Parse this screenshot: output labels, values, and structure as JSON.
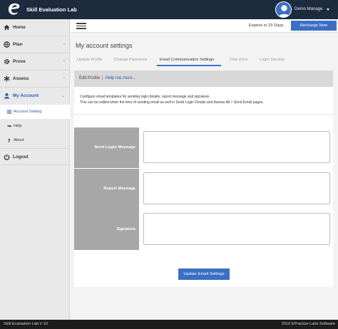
{
  "app": {
    "title": "Skill Evaluation Lab",
    "user_name": "Demo Manage"
  },
  "header": {
    "expires_text": "Expires in 23 Days.",
    "recharge_label": "Recharge Now"
  },
  "sidebar": {
    "items": [
      {
        "label": "Home",
        "icon": "home-icon"
      },
      {
        "label": "Plan",
        "icon": "globe-icon",
        "chevron": "‹"
      },
      {
        "label": "Prove",
        "icon": "cog-icon",
        "chevron": "‹"
      },
      {
        "label": "Assess",
        "icon": "asterisk-icon",
        "chevron": "‹"
      },
      {
        "label": "My Account",
        "icon": "user-icon",
        "chevron": "⌄"
      }
    ],
    "sub_items": [
      {
        "label": "Account Setting",
        "icon": "settings-icon"
      },
      {
        "label": "Help",
        "icon": "help-hand-icon"
      },
      {
        "label": "About",
        "icon": "question-icon"
      }
    ],
    "logout_label": "Logout"
  },
  "main": {
    "page_title": "My account settings",
    "tabs": [
      "Update Profile",
      "Change Password",
      "Email Communication Settings",
      "Time Zone",
      "Login Security"
    ],
    "active_tab": "Email Communication Settings",
    "panel": {
      "edit_profile": "Edit Profile",
      "separator": "|",
      "help_link": "Help me more...",
      "description_line1": "Configure email templates for sending login details, report message and signature.",
      "description_line2": "This can be edited when the time of sending email as well in Send Login Details and Assess All > Send Email pages."
    },
    "form": {
      "fields": [
        {
          "label": "Send Login Message",
          "value": ""
        },
        {
          "label": "Report Message",
          "value": ""
        },
        {
          "label": "Signature",
          "value": ""
        }
      ],
      "submit_label": "Update Email Settings"
    }
  },
  "footer": {
    "left": "Skill Evaluation Lab V 10",
    "right": "2016 EPractize Labs Software"
  },
  "colors": {
    "topbar": "#1c2b3d",
    "accent": "#3b6fc4",
    "label_bg": "#a7a7a7"
  }
}
